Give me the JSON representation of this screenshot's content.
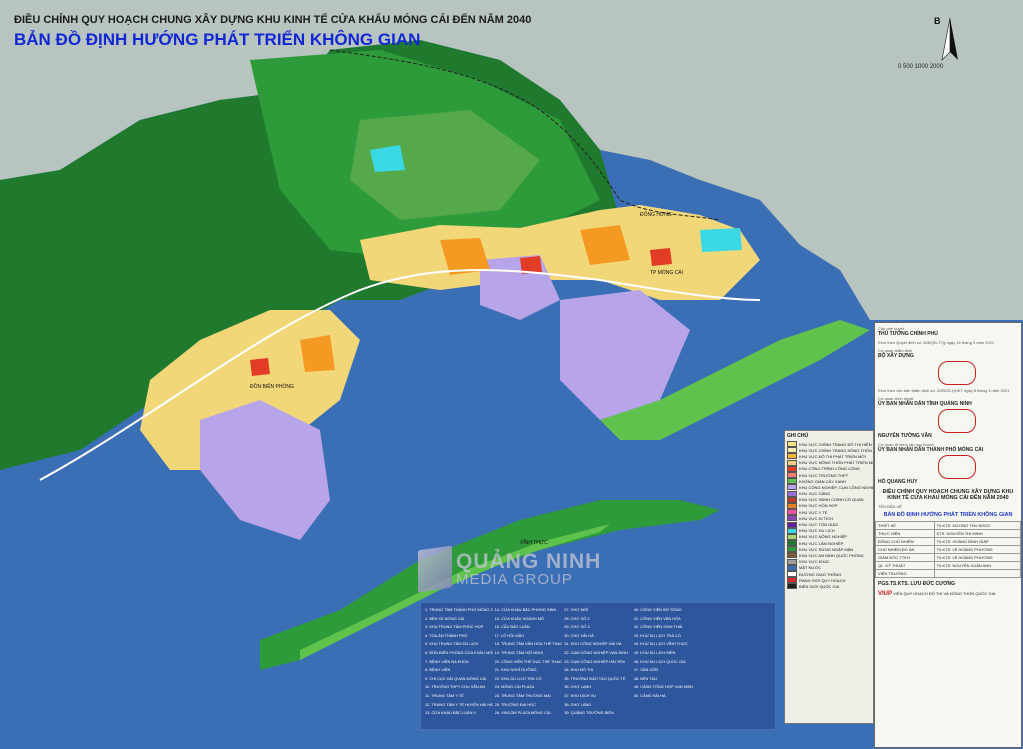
{
  "title": {
    "line1": "ĐIỀU CHỈNH QUY HOẠCH CHUNG XÂY DỰNG KHU KINH TẾ CỬA KHẨU MÓNG CÁI ĐẾN NĂM 2040",
    "line2": "BẢN ĐỒ ĐỊNH HƯỚNG PHÁT TRIỂN KHÔNG GIAN"
  },
  "north_arrow": {
    "label": "B"
  },
  "scale_bar": "0   500  1000       2000",
  "places": {
    "mong_cai_center": "TP MÓNG CÁI",
    "border_area": "ĐÔNG HƯNG",
    "left_area": "ĐỒN BIÊN PHÒNG",
    "island": "VĨNH THỰC"
  },
  "colors": {
    "sea": "#3b6fb5",
    "forest_dark": "#1f7a2e",
    "forest_mid": "#2e9b3a",
    "green_light": "#5ec24c",
    "residential": "#f2d779",
    "commercial": "#e23b26",
    "industrial": "#b8a4e8",
    "orange": "#f49a23",
    "cyan": "#3ad7e4",
    "china_terrain": "#b7c4bf"
  },
  "legend": {
    "header": "GHI CHÚ",
    "items": [
      {
        "label": "KHU VỰC CHỈNH TRANG ĐÔ THỊ HIỆN TRẠNG",
        "color": "#f2e38a"
      },
      {
        "label": "KHU VỰC CHỈNH TRANG NÔNG THÔN HIỆN TRẠNG",
        "color": "#f7efb4"
      },
      {
        "label": "KHU VỰC ĐÔ THỊ PHÁT TRIỂN MỚI",
        "color": "#f4b43a"
      },
      {
        "label": "KHU VỰC NÔNG THÔN PHÁT TRIỂN MỚI",
        "color": "#f6d08a"
      },
      {
        "label": "KHU CÔNG TRÌNH CÔNG CỘNG",
        "color": "#e23b26"
      },
      {
        "label": "KHU VỰC TRƯỜNG THPT",
        "color": "#ff7a70"
      },
      {
        "label": "KHÔNG GIAN CÂY XANH",
        "color": "#5ec24c"
      },
      {
        "label": "KHU CÔNG NGHIỆP, CỤM CÔNG NGHIỆP",
        "color": "#b8a4e8"
      },
      {
        "label": "KHU VỰC CẢNG",
        "color": "#9c6fd8"
      },
      {
        "label": "KHU VỰC HÀNH CHÍNH CÔ QUAN",
        "color": "#c0392b"
      },
      {
        "label": "KHU VỰC HỖN HỢP",
        "color": "#e67e22"
      },
      {
        "label": "KHU VỰC Y TẾ",
        "color": "#ff4da6"
      },
      {
        "label": "KHU VỰC DI TÍCH",
        "color": "#8e44ad"
      },
      {
        "label": "KHU VỰC TÔN GIÁO",
        "color": "#6a1b9a"
      },
      {
        "label": "KHU VỰC DU LỊCH",
        "color": "#3ad7e4"
      },
      {
        "label": "KHU VỰC NÔNG NGHIỆP",
        "color": "#a5d66b"
      },
      {
        "label": "KHU VỰC LÂM NGHIỆP",
        "color": "#1f7a2e"
      },
      {
        "label": "KHU VỰC RỪNG NGẬP MẶN",
        "color": "#2e9b3a"
      },
      {
        "label": "KHU VỰC AN NINH QUỐC PHÒNG",
        "color": "#7b5a3c"
      },
      {
        "label": "KHU VỰC KHÁC",
        "color": "#9e9e9e"
      },
      {
        "label": "MẶT NƯỚC",
        "color": "#3b6fb5"
      },
      {
        "label": "ĐƯỜNG GIAO THÔNG",
        "color": "#ffffff"
      },
      {
        "label": "RANH GIỚI QUY HOẠCH",
        "color": "#d62828"
      },
      {
        "label": "BIÊN GIỚI QUỐC GIA",
        "color": "#222222"
      }
    ]
  },
  "notes": [
    "1. TRUNG TÂM THÀNH PHỐ MÓNG CÁI",
    "2. BẾN XE MÓNG CÁI",
    "3. KHU TRUNG TÂM PHÚC HỢP",
    "4. TÒA ÁN THÀNH PHỐ",
    "5. KHU TRUNG TÂM DU LỊCH",
    "6. ĐỒN BIÊN PHÒNG CỬA KHẨU MÓNG CÁI",
    "7. BỆNH VIỆN ĐA KHOA",
    "8. BỆNH VIỆN",
    "9. CHI CỤC HẢI QUAN MÓNG CÁI",
    "10. TRƯỜNG THPT CHU VĂN AN",
    "11. TRUNG TÂM Y TẾ",
    "12. TRUNG TÂM Y TẾ HUYỆN HẢI HÀ",
    "13. CỬA KHẨU BẮC LUÂN II",
    "14. CỬA KHẨU BẮC PHONG SINH",
    "15. CỬA KHẨU HOÀNH MÔ",
    "16. CẦU BẮC LUÂN",
    "17. LÔ HỘI MẪU",
    "18. TRUNG TÂM VĂN HÓA THỂ THAO",
    "19. TRUNG TÂM HỘI NGHỊ",
    "20. CÔNG VIÊN THỂ DỤC THỂ THAO",
    "21. KHU NGHỈ DƯỠNG",
    "22. KHU DU LỊCH TRÀ CỔ",
    "23. MÓNG CÁI PLAZA",
    "24. TRUNG TÂM THƯƠNG MẠI",
    "25. TRƯỜNG ĐẠI HỌC",
    "26. VINCOM PLAZA MÓNG CÁI",
    "27. CHỢ MỚI",
    "28. CHỢ SỐ 2",
    "29. CHỢ SỐ 3",
    "30. CHỢ HẢI HÀ",
    "31. KHU CÔNG NGHIỆP HẢI HÀ",
    "32. CỤM CÔNG NGHIỆP VẠN NINH",
    "33. CỤM CÔNG NGHIỆP HẢI YÊN",
    "34. KHU ĐÔ THỊ",
    "35. TRƯỜNG ĐÀO TẠO QUỐC TẾ",
    "36. CHỢ LẠNH",
    "37. KHU DỊCH VỤ",
    "38. CHỢ LÀNG",
    "39. QUẢNG TRƯỜNG BIÊN",
    "40. CÔNG VIÊN BỜ SÔNG",
    "41. CÔNG VIÊN VĂN HÓA",
    "42. CÔNG VIÊN SINH THÁI",
    "43. KHU DU LỊCH TRÀ CỔ",
    "44. KHU DU LỊCH VĨNH THỰC",
    "45. KHU DU LỊCH BIỂN",
    "46. KHU DU LỊCH QUỐC GIA",
    "47. SÂN GÔN",
    "48. BẾN TÀU",
    "49. CẢNG TỔNG HỢP VẠN NINH",
    "50. CẢNG HẢI HÀ"
  ],
  "watermark": {
    "line1": "QUẢNG NINH",
    "line2": "MEDIA GROUP"
  },
  "panel": {
    "approval_label": "Cấp phê duyệt",
    "approver": "THỦ TƯỚNG CHÍNH PHỦ",
    "decision": "Kèm theo Quyết định số: 368/QĐ-TTg ngày 16 tháng 3 năm 2021",
    "appraisal_label": "Cơ quan thẩm định",
    "appraiser": "BỘ XÂY DỰNG",
    "appraisal_doc": "Kèm theo văn bản thẩm định số: 22/BXD-QHKT ngày 8 tháng 3 năm 2021",
    "submit_label": "Cơ quan trình duyệt",
    "submitter": "ỦY BAN NHÂN DÂN TỈNH QUẢNG NINH",
    "submitter_sign": "NGUYỄN TƯỜNG VĂN",
    "org_label": "Cơ quan tổ chức lập quy hoạch",
    "organizer": "ỦY BAN NHÂN DÂN THÀNH PHỐ MÓNG CÁI",
    "organizer_sign": "HỒ QUANG HUY",
    "project": "ĐIỀU CHỈNH QUY HOẠCH CHUNG XÂY DỰNG KHU KINH TẾ CỬA KHẨU MÓNG CÁI ĐẾN NĂM 2040",
    "map_label": "TÊN BẢN VẼ",
    "map_name": "BẢN ĐỒ ĐỊNH HƯỚNG PHÁT TRIỂN KHÔNG GIAN",
    "staff": [
      [
        "THIẾT KẾ",
        "Th.KTS. DƯƠNG THU NGỌC"
      ],
      [
        "THỰC HIỆN",
        "KTS. NGUYỄN THỊ MINH"
      ],
      [
        "ĐÔNG CHỦ NHIỆM",
        "Th.KTS. HOÀNG ĐÌNH GIÁP"
      ],
      [
        "CHỦ NHIỆM ĐỒ ÁN",
        "Th.KTS. LÊ HOÀNG PHƯƠNG"
      ],
      [
        "GIÁM ĐỐC TTKH",
        "Th.KTS. LÊ HOÀNG PHƯƠNG"
      ],
      [
        "QL. KỸ THUẬT",
        "Th.KTS. NGUYỄN XUÂN ANH"
      ],
      [
        "VIỆN TRƯỞNG",
        ""
      ]
    ],
    "director": "PGS.TS.KTS. LƯU ĐỨC CƯƠNG",
    "viup_logo": "VIUP",
    "viup_name": "VIỆN QUY HOẠCH ĐÔ THỊ VÀ NÔNG THÔN QUỐC GIA"
  }
}
